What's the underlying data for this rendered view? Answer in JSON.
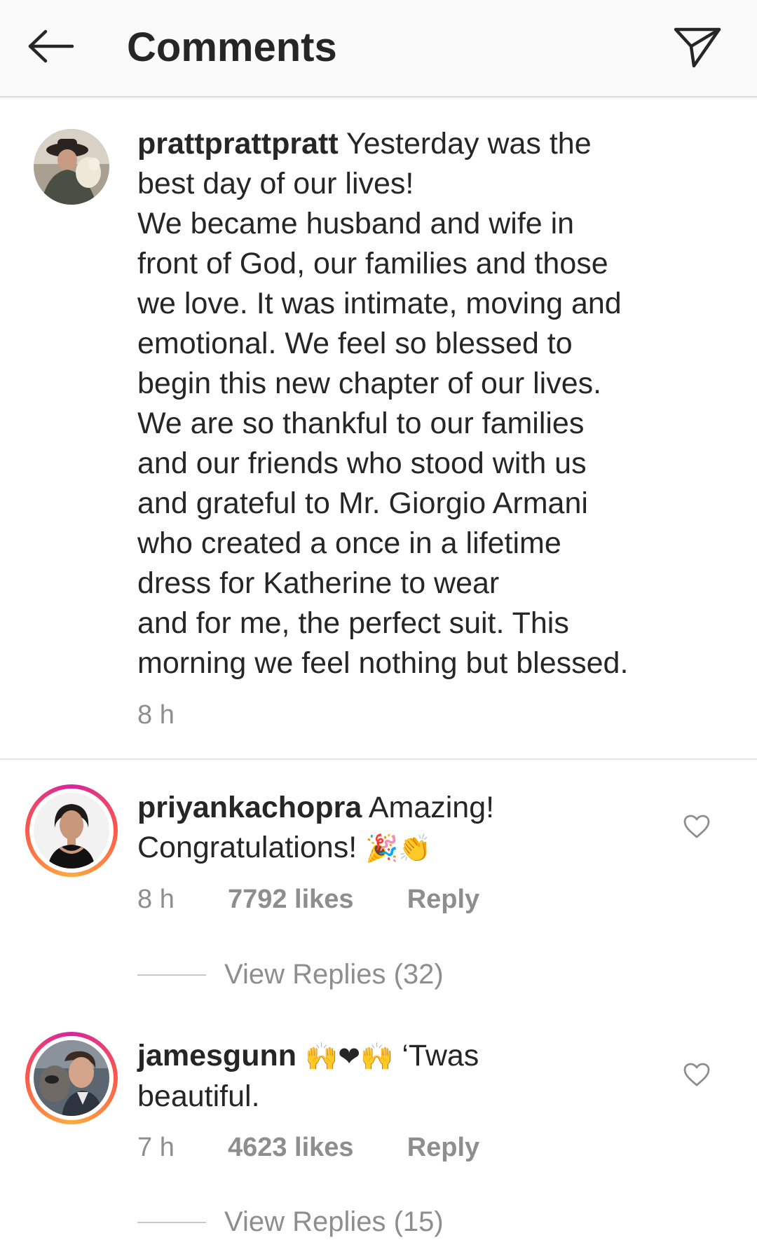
{
  "header": {
    "title": "Comments",
    "back_icon": "arrow-left-icon",
    "share_icon": "paper-plane-icon"
  },
  "post": {
    "username": "prattprattpratt",
    "caption": "Yesterday was the best day of our lives! We became husband and wife in front of God, our families and those we love.  It was intimate, moving and emotional. We feel so blessed to begin this new chapter of our lives. We are so thankful to our families and our friends who stood with us and grateful to Mr. Giorgio Armani who created a once in a lifetime dress for Katherine to wear and for me, the perfect suit. This morning we feel nothing but blessed.",
    "caption_lines": [
      "Yesterday was the",
      "best day of our lives!",
      "We became husband and wife in",
      "front of God, our families and those",
      "we love.  It was intimate, moving and",
      "emotional. We feel so blessed to",
      "begin this new chapter of our lives.",
      "We are so thankful to our families",
      "and our friends who stood with us",
      "and grateful to Mr. Giorgio Armani",
      "who created a once in a lifetime",
      "dress for Katherine to wear",
      "and for me, the perfect suit. This",
      "morning we feel nothing but blessed."
    ],
    "time": "8 h"
  },
  "comments": [
    {
      "username": "priyankachopra",
      "text_line1": "Amazing!",
      "text_line2": "Congratulations!",
      "emojis": "🎉👏",
      "time": "8 h",
      "likes": "7792 likes",
      "reply_label": "Reply",
      "view_replies": "View Replies (32)"
    },
    {
      "username": "jamesgunn",
      "emojis": "🙌❤🙌",
      "text_line1": "‘Twas",
      "text_line2": "beautiful.",
      "time": "7 h",
      "likes": "4623 likes",
      "reply_label": "Reply",
      "view_replies": "View Replies (15)"
    }
  ],
  "colors": {
    "text": "#262626",
    "secondary": "#8e8e8e",
    "header_bg": "#fafafa",
    "divider": "#e6e6e6",
    "story_ring_start": "#d6249f",
    "story_ring_end": "#fdab3d"
  }
}
